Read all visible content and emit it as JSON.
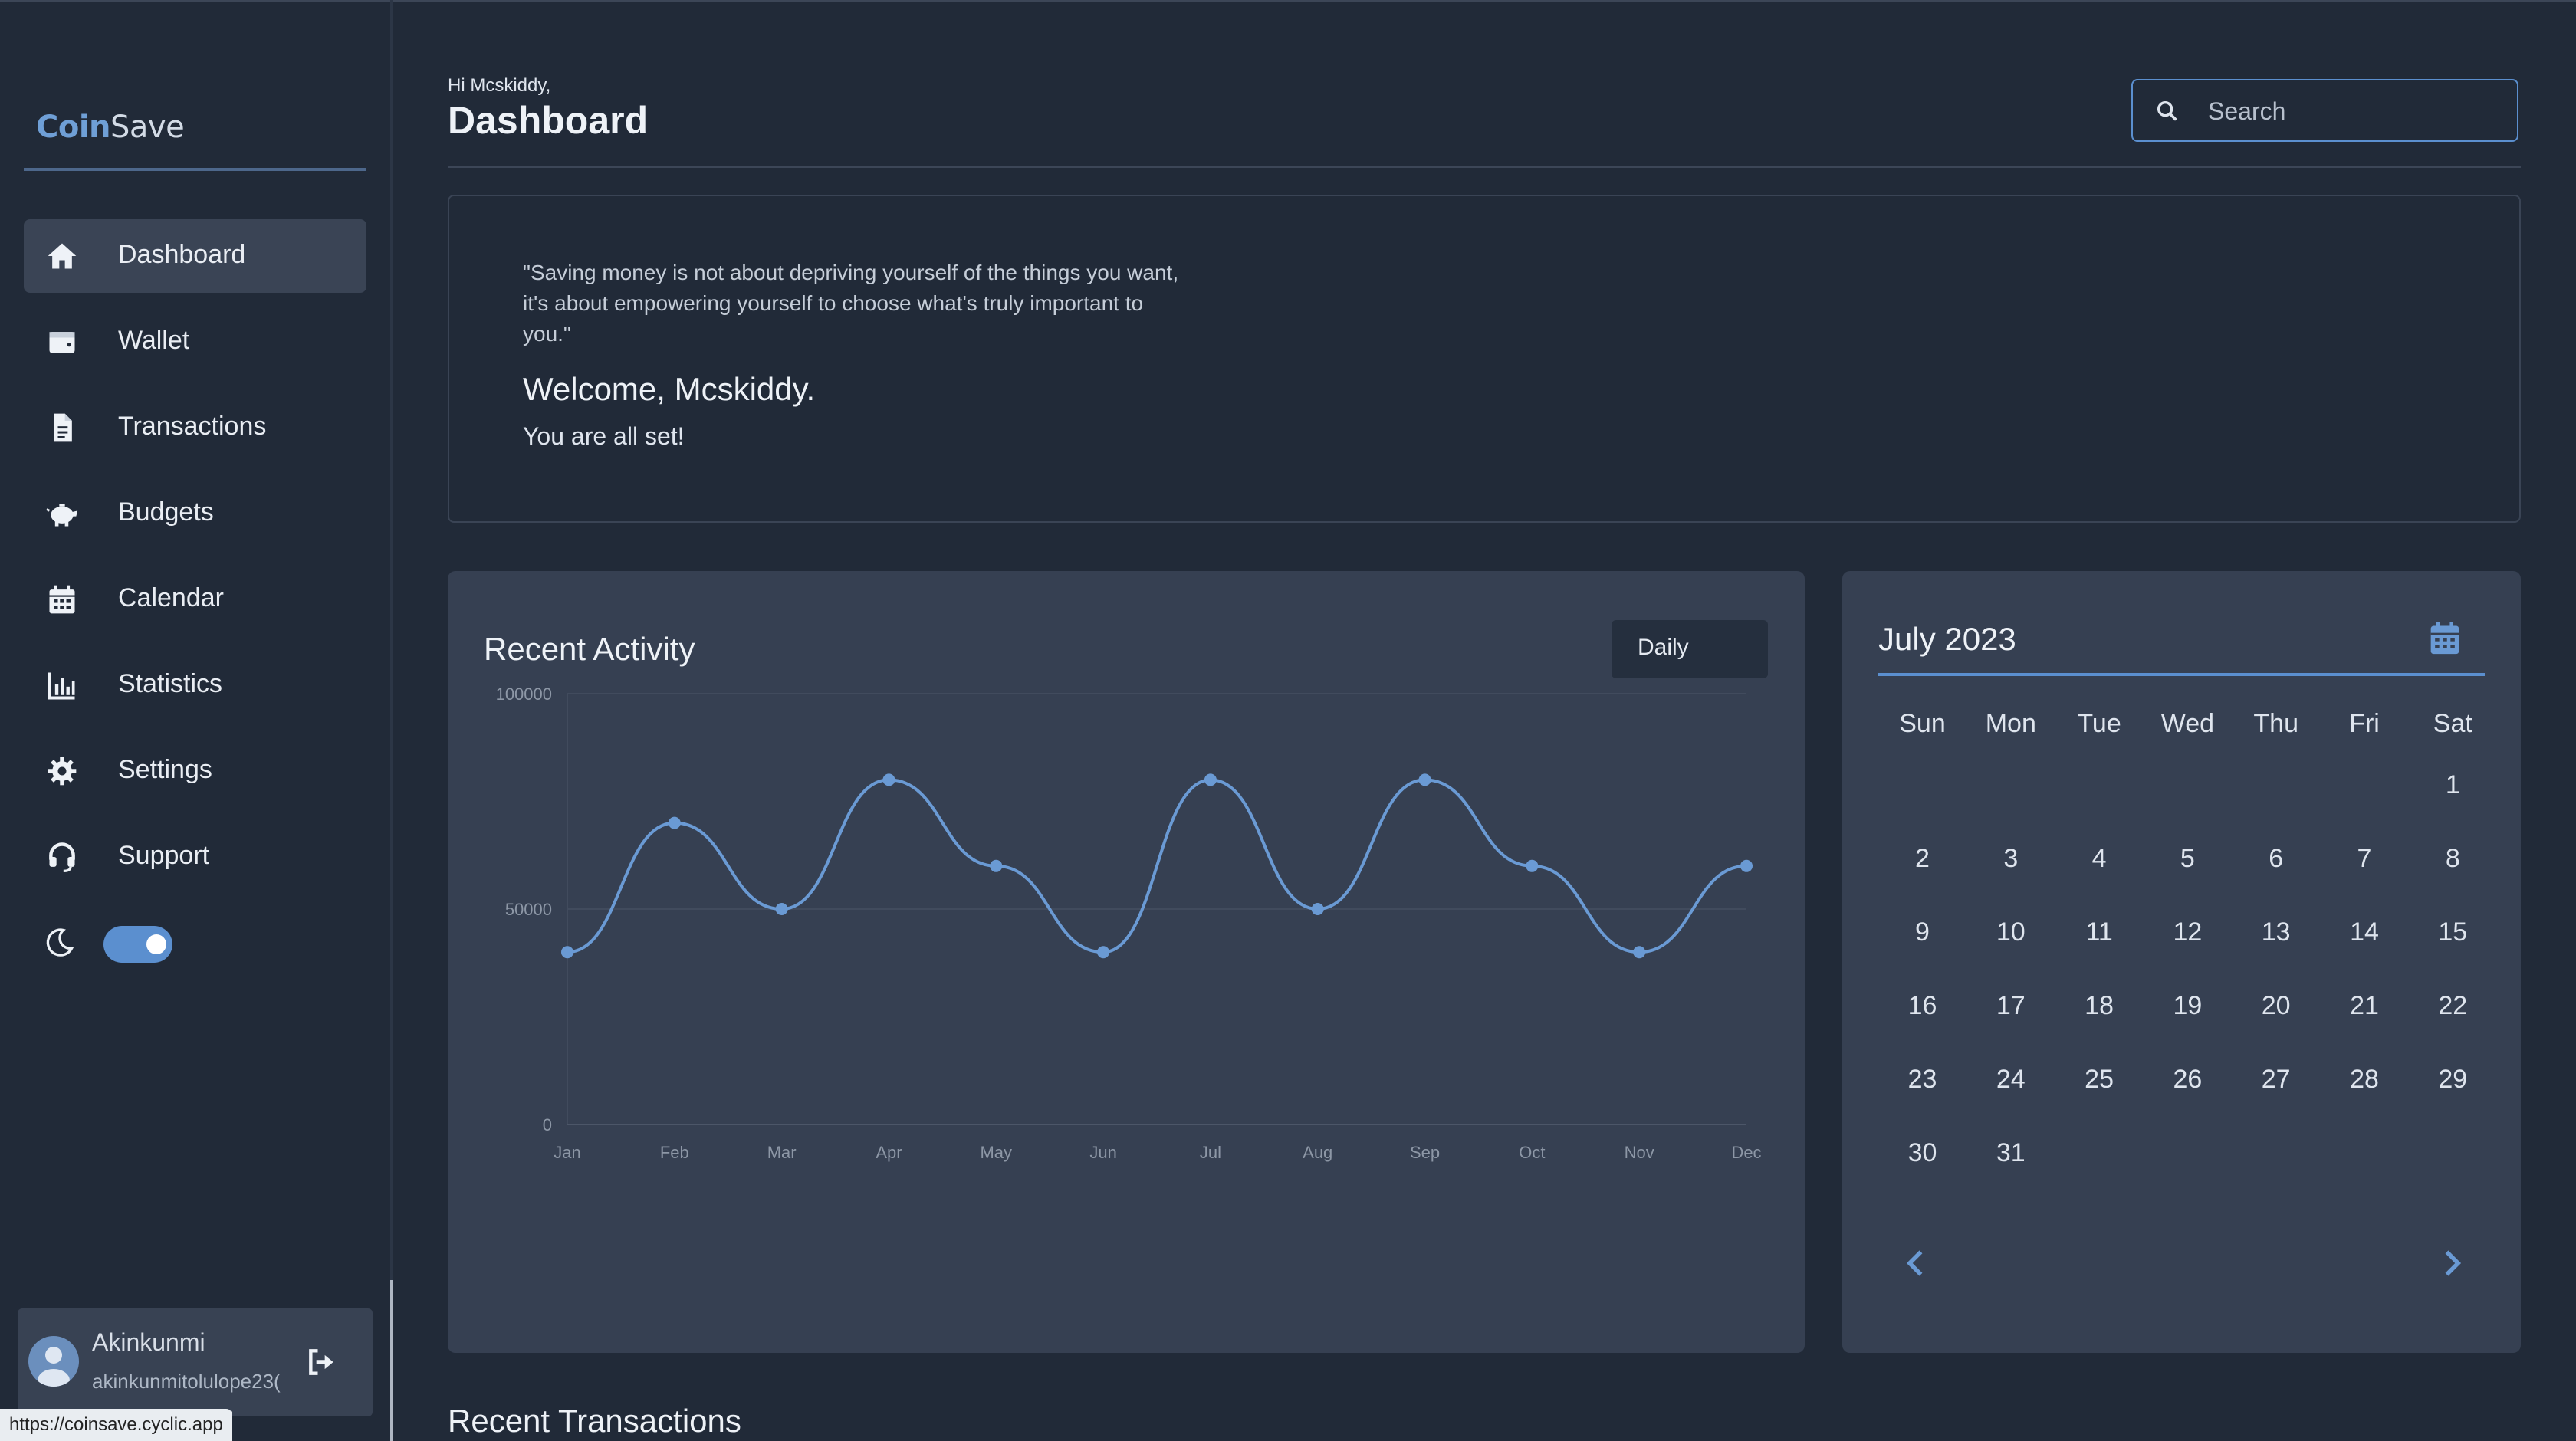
{
  "app": {
    "logo_part1": "Coin",
    "logo_part2": "Save"
  },
  "sidebar": {
    "items": [
      {
        "label": "Dashboard",
        "icon": "home-icon",
        "active": true
      },
      {
        "label": "Wallet",
        "icon": "wallet-icon"
      },
      {
        "label": "Transactions",
        "icon": "document-icon"
      },
      {
        "label": "Budgets",
        "icon": "piggy-bank-icon"
      },
      {
        "label": "Calendar",
        "icon": "calendar-icon"
      },
      {
        "label": "Statistics",
        "icon": "bar-chart-icon"
      },
      {
        "label": "Settings",
        "icon": "gear-icon"
      },
      {
        "label": "Support",
        "icon": "headset-icon"
      }
    ],
    "theme_toggle_on": true
  },
  "user": {
    "name": "Akinkunmi",
    "email": "akinkunmitolulope23("
  },
  "status_url": "https://coinsave.cyclic.app",
  "header": {
    "greeting": "Hi Mcskiddy,",
    "title": "Dashboard",
    "search_placeholder": "Search"
  },
  "welcome": {
    "quote": "\"Saving money is not about depriving yourself of the things you want, it's about empowering yourself to choose what's truly important to you.\"",
    "title": "Welcome, Mcskiddy.",
    "subtitle": "You are all set!"
  },
  "activity": {
    "title": "Recent Activity",
    "period": "Daily"
  },
  "chart_data": {
    "type": "line",
    "categories": [
      "Jan",
      "Feb",
      "Mar",
      "Apr",
      "May",
      "Jun",
      "Jul",
      "Aug",
      "Sep",
      "Oct",
      "Nov",
      "Dec"
    ],
    "series": [
      {
        "values": [
          40000,
          70000,
          50000,
          80000,
          60000,
          40000,
          80000,
          50000,
          80000,
          60000,
          40000,
          60000
        ]
      }
    ],
    "yticks": [
      0,
      50000,
      100000
    ],
    "ylim": [
      0,
      100000
    ],
    "smooth": true,
    "grid": true,
    "color": "#6a9ad4"
  },
  "calendar": {
    "month": "July 2023",
    "weekdays": [
      "Sun",
      "Mon",
      "Tue",
      "Wed",
      "Thu",
      "Fri",
      "Sat"
    ],
    "first_weekday_index": 6,
    "days_in_month": 31
  },
  "recent_transactions": {
    "title": "Recent Transactions"
  },
  "colors": {
    "background": "#212a38",
    "card": "#364052",
    "accent": "#5b8fcf"
  }
}
